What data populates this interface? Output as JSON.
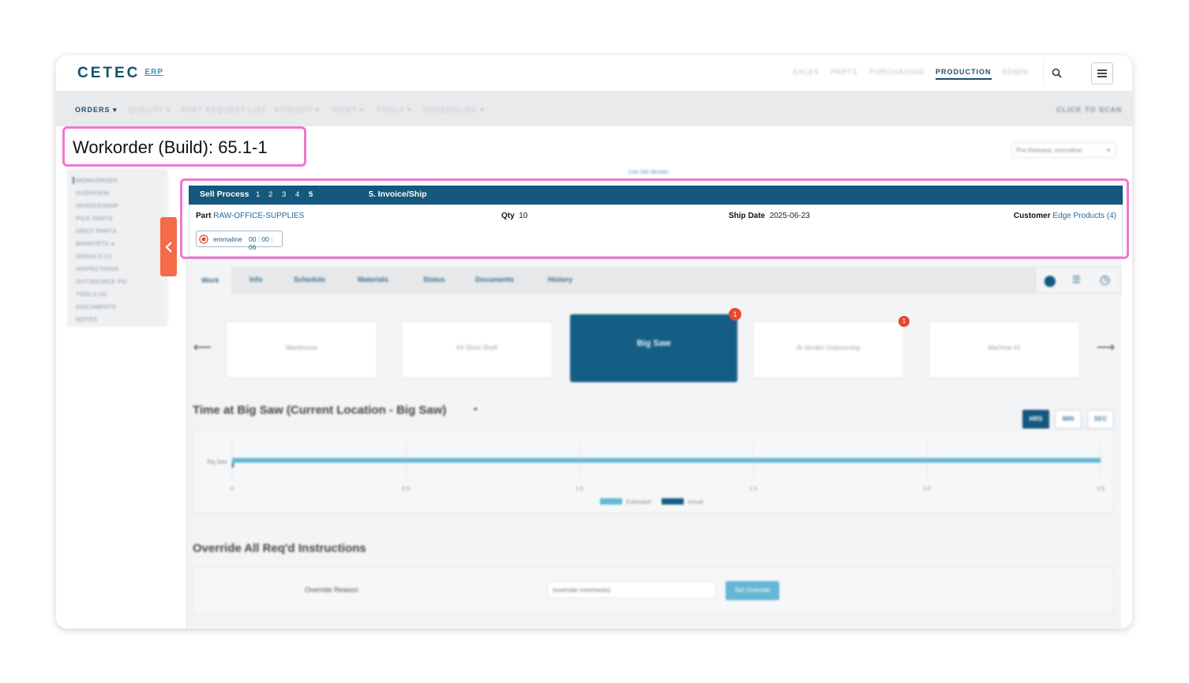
{
  "app": {
    "logo": "CETEC",
    "logo_suffix": "ERP"
  },
  "top_nav": [
    "SALES",
    "PARTS",
    "PURCHASING",
    "PRODUCTION",
    "ADMIN"
  ],
  "sub_nav": {
    "items": [
      "ORDERS ▾",
      "QUALITY ▾",
      "PART REQUEST LIST",
      "KITAUDIT ▾",
      "MGMT ▾",
      "TOOLS ▾",
      "SCHEDULING ▾"
    ],
    "click_to_scan": "CLICK TO SCAN"
  },
  "page": {
    "title": "Workorder (Build): 65.1-1",
    "prerelease": "Pre-Release: emmaline",
    "use_old_version": "Use Old Version"
  },
  "side_nav": [
    "WORKORDER",
    "OVERVIEW",
    "INVOICE/SHIP",
    "PICK PARTS",
    "DEKIT PARTS",
    "MAINT/ETC ▸",
    "SERIALS (1)",
    "INSPECTIONS",
    "OUTSOURCE PO",
    "TOOLS (0)",
    "DOCUMENTS",
    "NOTES"
  ],
  "sell_process": {
    "label": "Sell Process",
    "steps": [
      "1",
      "2",
      "3",
      "4",
      "5"
    ],
    "current_step_label": "5. Invoice/Ship"
  },
  "details": {
    "part_label": "Part",
    "part_value": "RAW-OFFICE-SUPPLIES",
    "qty_label": "Qty",
    "qty_value": "10",
    "ship_date_label": "Ship Date",
    "ship_date_value": "2025-06-23",
    "customer_label": "Customer",
    "customer_value": "Edge Products (4)",
    "timer_user": "emmaline",
    "timer_value": "00 : 00 : 06"
  },
  "tabs": [
    "Work",
    "Info",
    "Schedule",
    "Materials",
    "Status",
    "Documents",
    "History"
  ],
  "locations": [
    {
      "name": "Warehouse",
      "badge": ""
    },
    {
      "name": "Kit Short Shelf",
      "badge": ""
    },
    {
      "name": "Big Saw",
      "badge": "1"
    },
    {
      "name": "At Vendor Outsourcing",
      "badge": "1"
    },
    {
      "name": "Machine #1",
      "badge": ""
    }
  ],
  "time_section": {
    "title": "Time at Big Saw (Current Location - Big Saw)",
    "units": [
      "HRS",
      "MIN",
      "SEC"
    ],
    "active_unit": "HRS"
  },
  "chart_data": {
    "type": "bar",
    "orientation": "horizontal",
    "categories": [
      "Big Saw"
    ],
    "series": [
      {
        "name": "Estimated",
        "values": [
          2.5
        ]
      },
      {
        "name": "Actual",
        "values": [
          0.002
        ]
      }
    ],
    "x_ticks": [
      "0",
      "0.5",
      "1.0",
      "1.5",
      "2.0",
      "2.5"
    ],
    "xlim": [
      0,
      2.5
    ],
    "legend": "bottom",
    "colors": {
      "Estimated": "#63b7d4",
      "Actual": "#145e85"
    }
  },
  "override": {
    "title": "Override All Req'd Instructions",
    "reason_label": "Override Reason",
    "placeholder": "(override comments)",
    "button": "Set Override"
  },
  "colors": {
    "primary": "#14587d",
    "accent": "#f36b47",
    "highlight": "#ee78cc",
    "badge": "#e8472f"
  }
}
